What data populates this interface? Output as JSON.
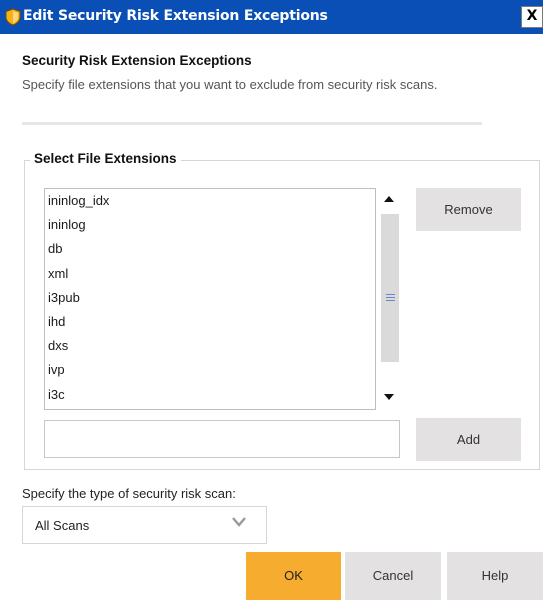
{
  "window": {
    "title": "Edit Security Risk Extension Exceptions",
    "close_label": "X",
    "title_bar_color": "#0a4fb5",
    "icon": "shield-icon"
  },
  "section": {
    "heading": "Security Risk Extension Exceptions",
    "description": "Specify file extensions that you want to exclude from security risk scans."
  },
  "file_extensions": {
    "legend": "Select File Extensions",
    "items": [
      "ininlog_idx",
      "ininlog",
      "db",
      "xml",
      "i3pub",
      "ihd",
      "dxs",
      "ivp",
      "i3c"
    ],
    "remove_label": "Remove",
    "add_label": "Add",
    "input_value": ""
  },
  "scan_type": {
    "label": "Specify the type of security risk scan:",
    "selected": "All Scans"
  },
  "footer": {
    "ok_label": "OK",
    "cancel_label": "Cancel",
    "help_label": "Help",
    "ok_color": "#f6ac2f"
  }
}
